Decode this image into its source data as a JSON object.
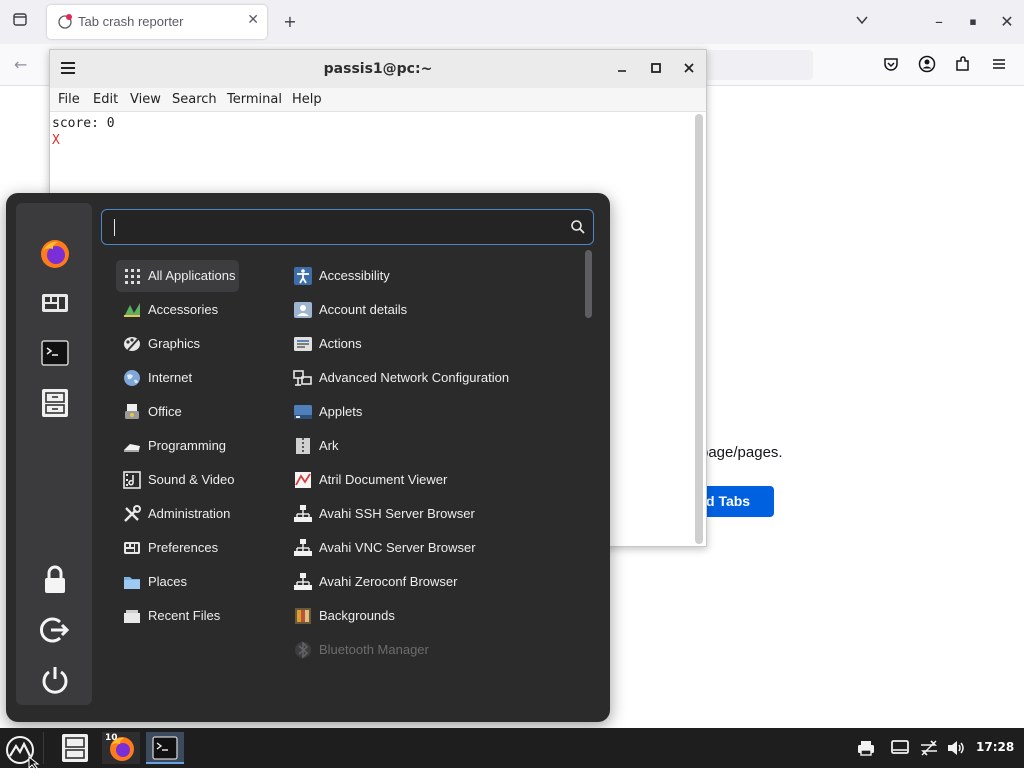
{
  "firefox": {
    "tab_title": "Tab crash reporter",
    "page_text_fragment": "page/pages.",
    "page_button_fragment": "d Tabs"
  },
  "terminal": {
    "title": "passis1@pc:~",
    "menu": [
      "File",
      "Edit",
      "View",
      "Search",
      "Terminal",
      "Help"
    ],
    "lines": [
      "score: 0",
      "X"
    ],
    "line_colors": [
      "#222222",
      "#e03030"
    ]
  },
  "whisker_menu": {
    "search_placeholder": "",
    "categories": [
      {
        "label": "All Applications",
        "icon": "grid-icon",
        "selected": true
      },
      {
        "label": "Accessories",
        "icon": "accessories-icon"
      },
      {
        "label": "Graphics",
        "icon": "graphics-icon"
      },
      {
        "label": "Internet",
        "icon": "globe-icon"
      },
      {
        "label": "Office",
        "icon": "office-icon"
      },
      {
        "label": "Programming",
        "icon": "programming-icon"
      },
      {
        "label": "Sound & Video",
        "icon": "media-icon"
      },
      {
        "label": "Administration",
        "icon": "tools-icon"
      },
      {
        "label": "Preferences",
        "icon": "preferences-icon"
      },
      {
        "label": "Places",
        "icon": "folder-icon"
      },
      {
        "label": "Recent Files",
        "icon": "recent-files-icon"
      }
    ],
    "apps": [
      {
        "label": "Accessibility",
        "icon": "accessibility-icon"
      },
      {
        "label": "Account details",
        "icon": "account-icon"
      },
      {
        "label": "Actions",
        "icon": "actions-icon"
      },
      {
        "label": "Advanced Network Configuration",
        "icon": "network-icon"
      },
      {
        "label": "Applets",
        "icon": "applets-icon"
      },
      {
        "label": "Ark",
        "icon": "archive-icon"
      },
      {
        "label": "Atril Document Viewer",
        "icon": "document-viewer-icon"
      },
      {
        "label": "Avahi SSH Server Browser",
        "icon": "avahi-icon"
      },
      {
        "label": "Avahi VNC Server Browser",
        "icon": "avahi-icon"
      },
      {
        "label": "Avahi Zeroconf Browser",
        "icon": "avahi-icon"
      },
      {
        "label": "Backgrounds",
        "icon": "backgrounds-icon"
      },
      {
        "label": "Bluetooth Manager",
        "icon": "bluetooth-icon",
        "dim": true
      }
    ],
    "sidebar": [
      "firefox-icon",
      "settings-manager-icon",
      "terminal-icon",
      "file-manager-icon",
      "lock-icon",
      "logout-icon",
      "power-icon"
    ]
  },
  "taskbar": {
    "clock": "17:28",
    "firefox_badge": "10"
  },
  "colors": {
    "menu_bg": "#2b2b2c",
    "sidebar_bg": "#3b3b3d",
    "search_border": "#4a86c8",
    "firefox_button": "#0061e0"
  }
}
